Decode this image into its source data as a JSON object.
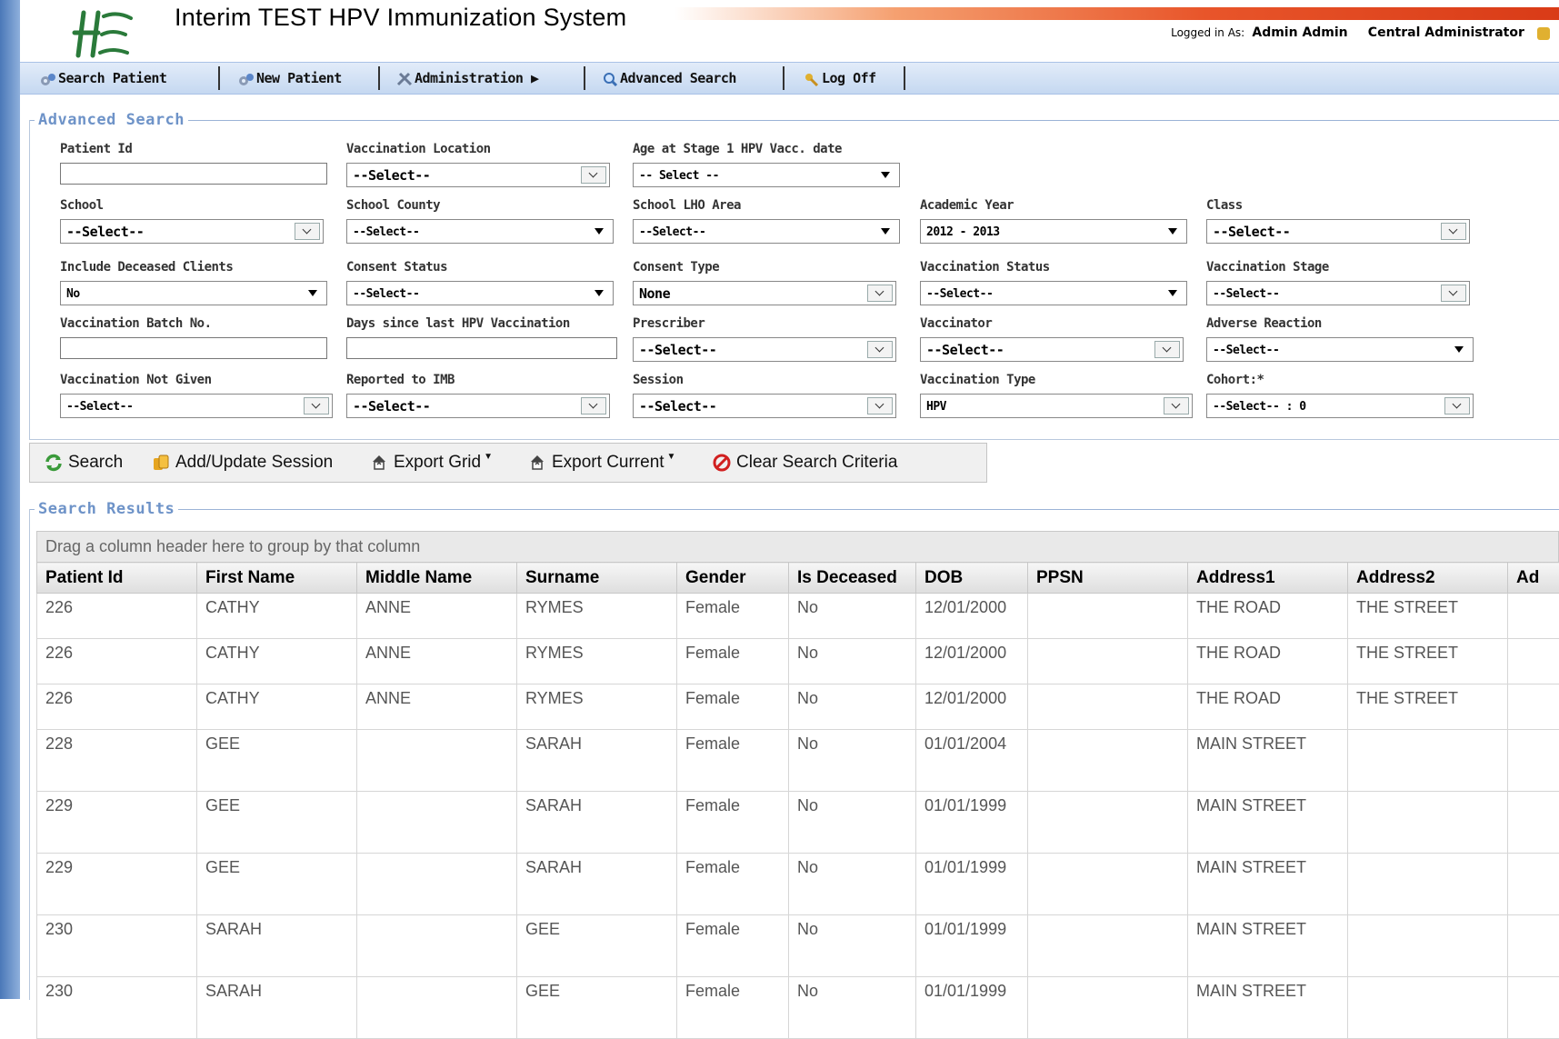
{
  "header": {
    "app_title": "Interim TEST HPV Immunization System",
    "logged_in_label": "Logged in As:",
    "user_name": "Admin Admin",
    "user_role": "Central Administrator"
  },
  "menu": [
    {
      "label": "Search Patient",
      "icon": "gears-icon"
    },
    {
      "label": "New Patient",
      "icon": "gears-icon"
    },
    {
      "label": "Administration",
      "icon": "tools-icon"
    },
    {
      "label": "Advanced Search",
      "icon": "magnifier-icon"
    },
    {
      "label": "Log Off",
      "icon": "keys-icon"
    }
  ],
  "advanced_search": {
    "legend": "Advanced Search",
    "fields": {
      "patient_id": {
        "label": "Patient Id",
        "value": ""
      },
      "vaccination_location": {
        "label": "Vaccination Location",
        "value": "--Select--"
      },
      "age_stage1": {
        "label": "Age at Stage 1 HPV Vacc. date",
        "value": "-- Select --"
      },
      "school": {
        "label": "School",
        "value": "--Select--"
      },
      "school_county": {
        "label": "School County",
        "value": "--Select--"
      },
      "school_lho_area": {
        "label": "School LHO Area",
        "value": "--Select--"
      },
      "academic_year": {
        "label": "Academic Year",
        "value": "2012 - 2013"
      },
      "class": {
        "label": "Class",
        "value": "--Select--"
      },
      "include_deceased": {
        "label": "Include Deceased Clients",
        "value": "No"
      },
      "consent_status": {
        "label": "Consent Status",
        "value": "--Select--"
      },
      "consent_type": {
        "label": "Consent Type",
        "value": "None"
      },
      "vaccination_status": {
        "label": "Vaccination Status",
        "value": "--Select--"
      },
      "vaccination_stage": {
        "label": "Vaccination Stage",
        "value": "--Select--"
      },
      "batch_no": {
        "label": "Vaccination Batch No.",
        "value": ""
      },
      "days_since": {
        "label": "Days since last HPV Vaccination",
        "value": ""
      },
      "prescriber": {
        "label": "Prescriber",
        "value": "--Select--"
      },
      "vaccinator": {
        "label": "Vaccinator",
        "value": "--Select--"
      },
      "adverse_reaction": {
        "label": "Adverse Reaction",
        "value": "--Select--"
      },
      "not_given": {
        "label": "Vaccination Not Given",
        "value": "--Select--"
      },
      "reported_imb": {
        "label": "Reported to IMB",
        "value": "--Select--"
      },
      "session": {
        "label": "Session",
        "value": "--Select--"
      },
      "vaccination_type": {
        "label": "Vaccination Type",
        "value": "HPV"
      },
      "cohort": {
        "label": "Cohort:*",
        "value": "--Select-- : 0"
      }
    }
  },
  "toolbar": {
    "search": "Search",
    "add_update_session": "Add/Update Session",
    "export_grid": "Export Grid",
    "export_current": "Export Current",
    "clear_criteria": "Clear Search Criteria"
  },
  "results": {
    "legend": "Search Results",
    "group_hint": "Drag a column header here to group by that column",
    "columns": [
      "Patient Id",
      "First Name",
      "Middle Name",
      "Surname",
      "Gender",
      "Is Deceased",
      "DOB",
      "PPSN",
      "Address1",
      "Address2",
      "Ad"
    ],
    "rows": [
      [
        "226",
        "CATHY",
        "ANNE",
        "RYMES",
        "Female",
        "No",
        "12/01/2000",
        "",
        "THE ROAD",
        "THE STREET",
        ""
      ],
      [
        "226",
        "CATHY",
        "ANNE",
        "RYMES",
        "Female",
        "No",
        "12/01/2000",
        "",
        "THE ROAD",
        "THE STREET",
        ""
      ],
      [
        "226",
        "CATHY",
        "ANNE",
        "RYMES",
        "Female",
        "No",
        "12/01/2000",
        "",
        "THE ROAD",
        "THE STREET",
        ""
      ],
      [
        "228",
        "GEE",
        "",
        "SARAH",
        "Female",
        "No",
        "01/01/2004",
        "",
        "MAIN STREET",
        "",
        ""
      ],
      [
        "229",
        "GEE",
        "",
        "SARAH",
        "Female",
        "No",
        "01/01/1999",
        "",
        "MAIN STREET",
        "",
        ""
      ],
      [
        "229",
        "GEE",
        "",
        "SARAH",
        "Female",
        "No",
        "01/01/1999",
        "",
        "MAIN STREET",
        "",
        ""
      ],
      [
        "230",
        "SARAH",
        "",
        "GEE",
        "Female",
        "No",
        "01/01/1999",
        "",
        "MAIN STREET",
        "",
        ""
      ],
      [
        "230",
        "SARAH",
        "",
        "GEE",
        "Female",
        "No",
        "01/01/1999",
        "",
        "MAIN STREET",
        "",
        ""
      ]
    ]
  },
  "colors": {
    "menu_bg": "#c5d8f1",
    "legend": "#6e93c8",
    "stripe": "#e8552a"
  }
}
